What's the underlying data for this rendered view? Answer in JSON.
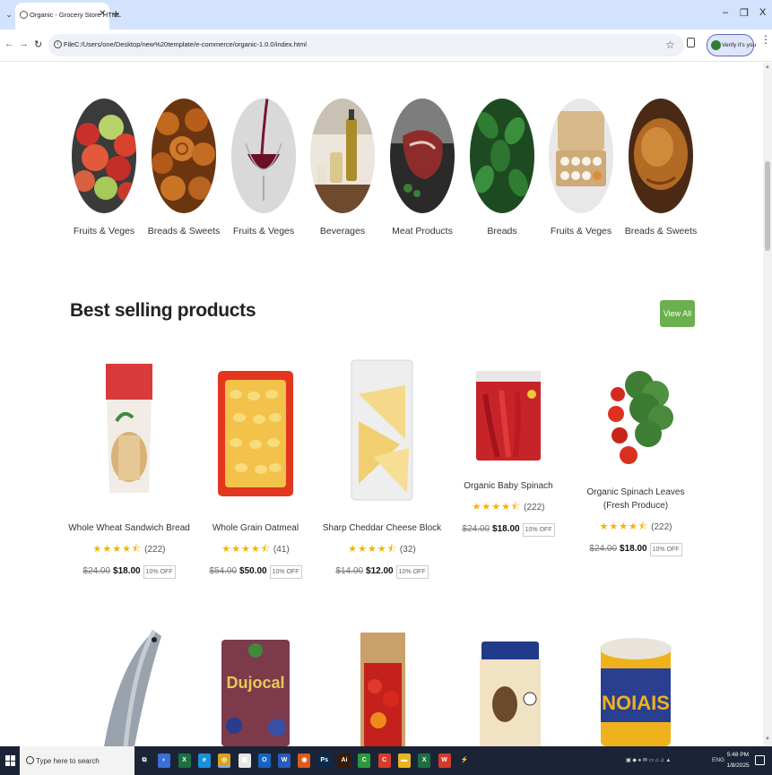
{
  "browser": {
    "tab_title": "Organic - Grocery Store HTML",
    "file_label": "File",
    "url": "C:/Users/one/Desktop/new%20template/e-commerce/organic-1.0.0/index.html",
    "verify_label": "Verify it's you",
    "minimize": "–",
    "restore": "❐",
    "close": "X",
    "new_tab": "+",
    "tab_close": "✕"
  },
  "categories": [
    {
      "label": "Fruits & Veges",
      "icon": "apples-image"
    },
    {
      "label": "Breads & Sweets",
      "icon": "pastries-image"
    },
    {
      "label": "Fruits & Veges",
      "icon": "wine-glass-image"
    },
    {
      "label": "Beverages",
      "icon": "oil-bottles-image"
    },
    {
      "label": "Meat Products",
      "icon": "steak-image"
    },
    {
      "label": "Breads",
      "icon": "mint-leaves-image"
    },
    {
      "label": "Fruits & Veges",
      "icon": "eggs-carton-image"
    },
    {
      "label": "Breads & Sweets",
      "icon": "roast-bread-image"
    }
  ],
  "section": {
    "title": "Best selling products",
    "view_all": "View All"
  },
  "products": [
    {
      "name": "Whole Wheat Sandwich Bread",
      "reviews": "(222)",
      "old_price": "$24.00",
      "price": "$18.00",
      "discount": "10% OFF",
      "rating": 4.5
    },
    {
      "name": "Whole Grain Oatmeal",
      "reviews": "(41)",
      "old_price": "$54.00",
      "price": "$50.00",
      "discount": "10% OFF",
      "rating": 4.5
    },
    {
      "name": "Sharp Cheddar Cheese Block",
      "reviews": "(32)",
      "old_price": "$14.00",
      "price": "$12.00",
      "discount": "10% OFF",
      "rating": 4.5
    },
    {
      "name": "Organic Baby Spinach",
      "reviews": "(222)",
      "old_price": "$24.00",
      "price": "$18.00",
      "discount": "10% OFF",
      "rating": 4.5
    },
    {
      "name": "Organic Spinach Leaves (Fresh Produce)",
      "reviews": "(222)",
      "old_price": "$24.00",
      "price": "$18.00",
      "discount": "10% OFF",
      "rating": 4.5
    }
  ],
  "taskbar": {
    "search_placeholder": "Type here to search",
    "time": "5:48 PM",
    "date": "1/8/2025",
    "language": "ENG",
    "apps": [
      "task-view",
      "copilot",
      "excel-sheets",
      "edge",
      "chrome",
      "files",
      "outlook",
      "word",
      "app-orange",
      "photoshop",
      "illustrator",
      "app-green",
      "app-red",
      "file-explorer",
      "excel",
      "wps",
      "app-stripe"
    ]
  },
  "colors": {
    "accent_green": "#6ab04c",
    "star_yellow": "#f5b301",
    "tab_strip": "#d3e3fd",
    "taskbar": "#1b2436"
  }
}
